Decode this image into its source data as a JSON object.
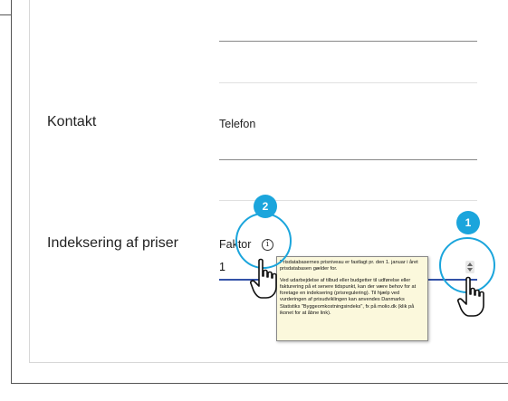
{
  "contact": {
    "section_label": "Kontakt",
    "phone_label": "Telefon"
  },
  "indexing": {
    "section_label": "Indeksering af priser",
    "factor_label": "Faktor",
    "factor_value": "1"
  },
  "info_icon": {
    "glyph": "i",
    "icon_name": "info-icon"
  },
  "tooltip": {
    "paragraphs": [
      "Prisdatabasernes prisniveau er fastlagt pr. den 1. januar i året prisdatabasen gælder for.",
      "Ved udarbejdelse af tilbud eller budgetter til udførelse eller fakturering på et senere tidspunkt, kan der være behov for at foretage en indeksering (prisregulering). Til hjælp ved vurderingen af prisudviklingen kan anvendes Danmarks Statistiks \"Byggeomkostningsindeks\", fx på molio.dk (klik på ikonet for at åbne link)."
    ]
  },
  "callouts": {
    "badge_1": "1",
    "badge_2": "2",
    "accent_color": "#1ba5dc"
  },
  "spinner": {
    "icon_name": "stepper-arrows-icon"
  },
  "cursor": {
    "icon_name": "hand-pointer-icon"
  }
}
